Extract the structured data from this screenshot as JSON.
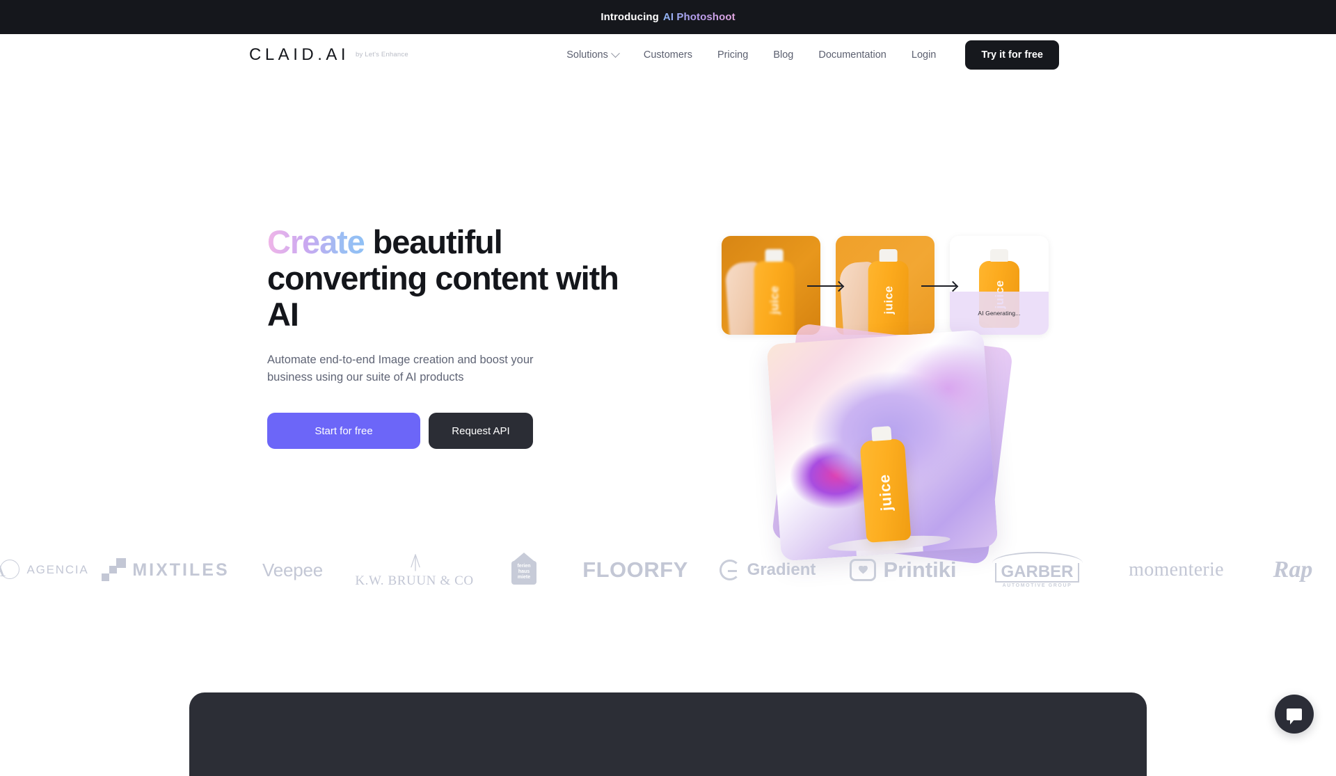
{
  "announcement": {
    "prefix": "Introducing",
    "highlight": "AI Photoshoot",
    "background": "#15171c",
    "gradient": "#b79ef0"
  },
  "header": {
    "brand": "CLAID.AI",
    "brand_sub": "by Let's Enhance",
    "nav": [
      {
        "label": "Solutions",
        "has_dropdown": true
      },
      {
        "label": "Customers",
        "has_dropdown": false
      },
      {
        "label": "Pricing",
        "has_dropdown": false
      },
      {
        "label": "Blog",
        "has_dropdown": false
      },
      {
        "label": "Documentation",
        "has_dropdown": false
      },
      {
        "label": "Login",
        "has_dropdown": false
      }
    ],
    "cta_label": "Try it for free"
  },
  "hero": {
    "headline_highlight": "Create",
    "headline_rest": " beautiful converting content with AI",
    "subtitle": "Automate end-to-end Image creation and boost your business using our suite of AI products",
    "primary_button": "Start for free",
    "secondary_button": "Request API",
    "primary_color": "#6c66f8",
    "secondary_color": "#2b2d35",
    "product_label": "juice",
    "generating_label": "AI Generating..."
  },
  "logos": [
    {
      "name": "agencia",
      "label": "AGENCIA"
    },
    {
      "name": "mixtiles",
      "label": "MIXTILES"
    },
    {
      "name": "veepee",
      "label": "Veepee"
    },
    {
      "name": "kw-bruun",
      "label": "K.W. BRUUN & CO"
    },
    {
      "name": "ferienhausmiete",
      "line1": "ferien",
      "line2": "haus",
      "line3": "miete"
    },
    {
      "name": "floorfy",
      "label": "FLOORFY"
    },
    {
      "name": "gradient",
      "label": "Gradient"
    },
    {
      "name": "printiki",
      "label": "Printiki"
    },
    {
      "name": "garber",
      "label": "GARBER",
      "sub": "AUTOMOTIVE GROUP"
    },
    {
      "name": "momenterie",
      "label": "momenterie"
    },
    {
      "name": "rapid",
      "label": "Rap"
    }
  ],
  "chat": {
    "label": "chat-bubble-icon"
  }
}
